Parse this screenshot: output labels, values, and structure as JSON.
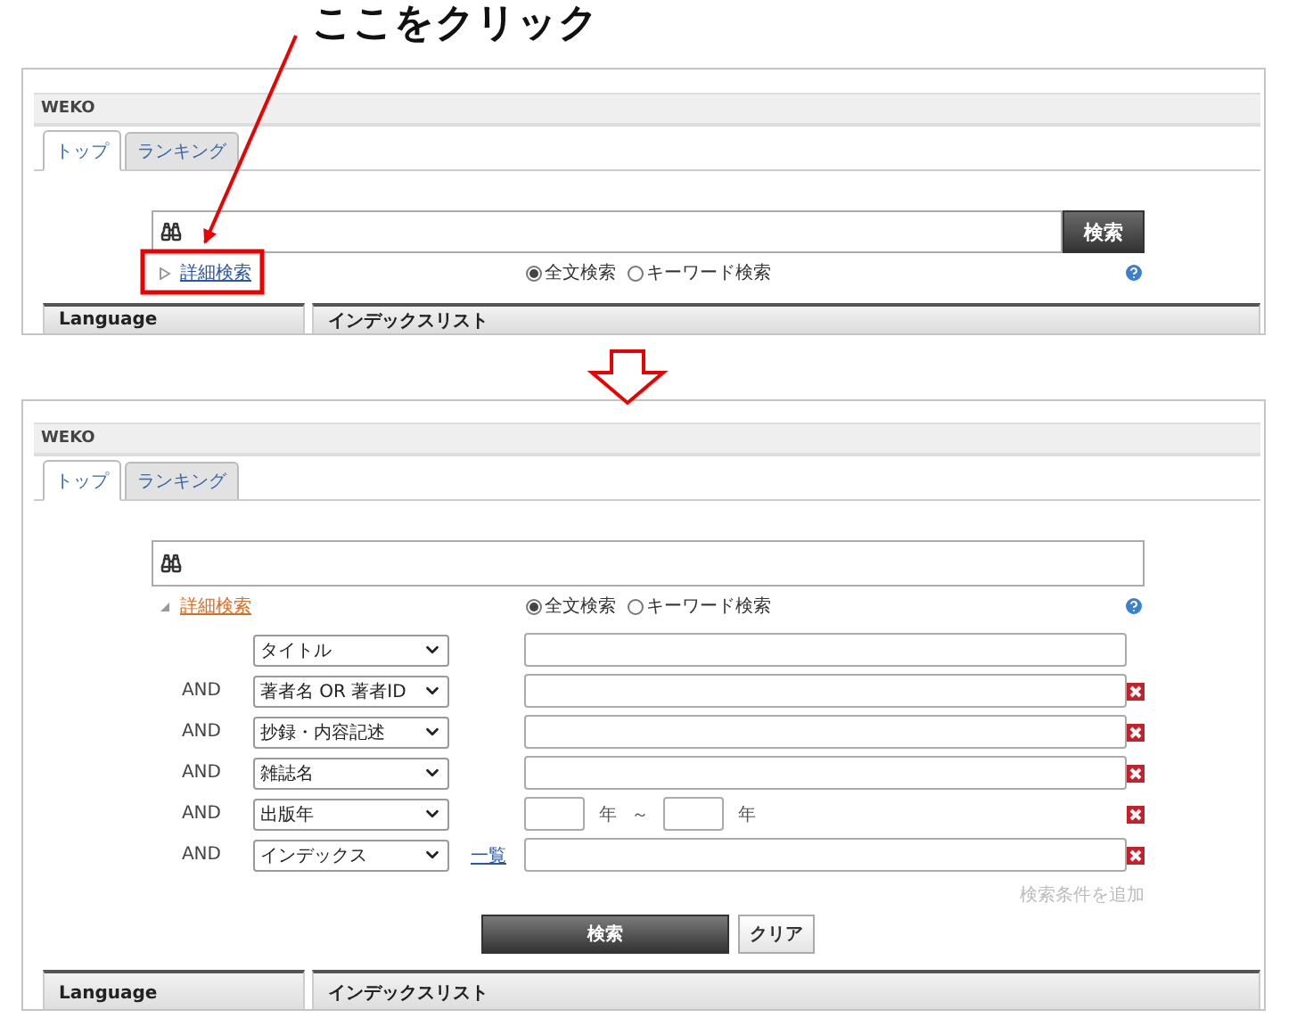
{
  "annotation": {
    "text": "ここをクリック"
  },
  "screens": [
    {
      "header": "WEKO",
      "tabs": [
        {
          "label": "トップ",
          "selected": true
        },
        {
          "label": "ランキング",
          "selected": false
        }
      ],
      "search_button": "検索",
      "advanced_link": "詳細検索",
      "expanded": false,
      "modes": [
        {
          "label": "全文検索",
          "selected": true
        },
        {
          "label": "キーワード検索",
          "selected": false
        }
      ],
      "panels": [
        "Language",
        "インデックスリスト"
      ]
    },
    {
      "header": "WEKO",
      "tabs": [
        {
          "label": "トップ",
          "selected": true
        },
        {
          "label": "ランキング",
          "selected": false
        }
      ],
      "advanced_link": "詳細検索",
      "expanded": true,
      "modes": [
        {
          "label": "全文検索",
          "selected": true
        },
        {
          "label": "キーワード検索",
          "selected": false
        }
      ],
      "conditions": [
        {
          "kind": "text",
          "field": "タイトル",
          "removable": false
        },
        {
          "kind": "text",
          "connector": "AND",
          "field": "著者名 OR 著者ID",
          "removable": true
        },
        {
          "kind": "text",
          "connector": "AND",
          "field": "抄録・内容記述",
          "removable": true
        },
        {
          "kind": "text",
          "connector": "AND",
          "field": "雑誌名",
          "removable": true
        },
        {
          "kind": "range",
          "connector": "AND",
          "field": "出版年",
          "from_unit": "年",
          "separator": "～",
          "to_unit": "年",
          "removable": true
        },
        {
          "kind": "index",
          "connector": "AND",
          "field": "インデックス",
          "link": "一覧",
          "removable": true
        }
      ],
      "add_condition": "検索条件を追加",
      "buttons": [
        {
          "kind": "primary",
          "label": "検索"
        },
        {
          "kind": "secondary",
          "label": "クリア"
        }
      ],
      "panels": [
        "Language",
        "インデックスリスト"
      ]
    }
  ]
}
